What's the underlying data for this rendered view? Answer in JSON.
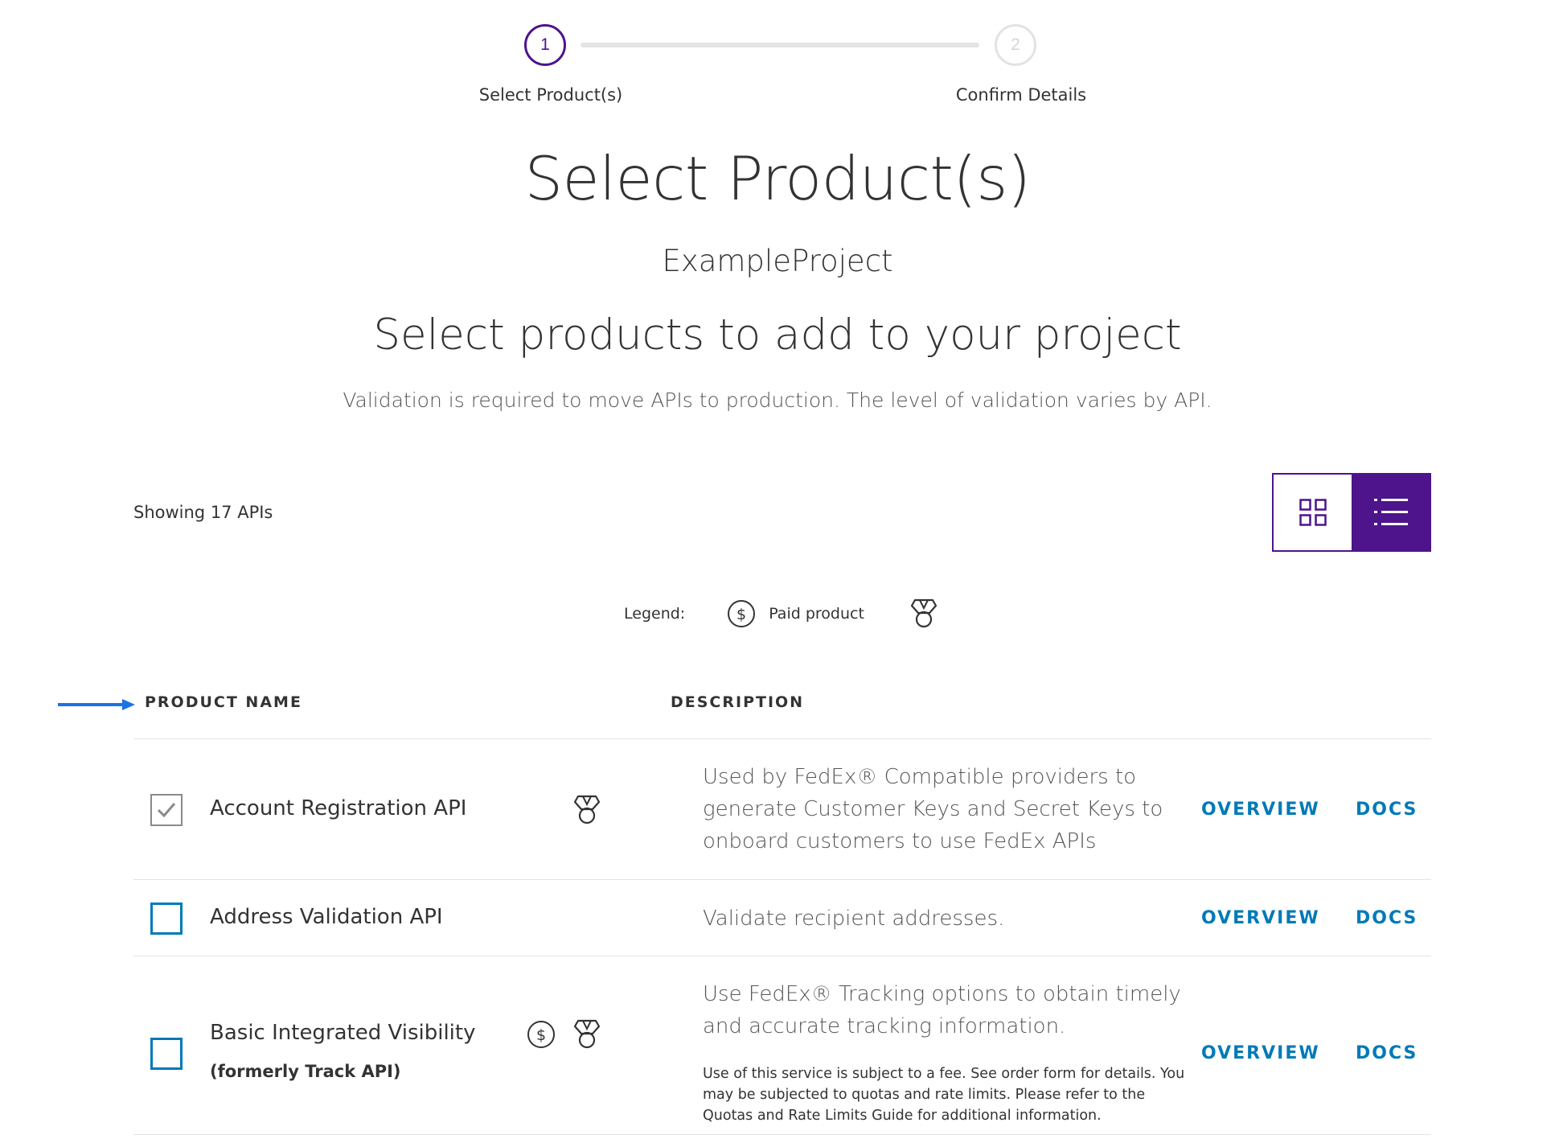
{
  "stepper": {
    "steps": [
      {
        "number": "1",
        "label": "Select Product(s)",
        "state": "active"
      },
      {
        "number": "2",
        "label": "Confirm Details",
        "state": "inactive"
      }
    ]
  },
  "page": {
    "title": "Select Product(s)",
    "project_name": "ExampleProject",
    "heading": "Select products to add to your project",
    "subtext": "Validation is required to move APIs to production. The level of validation varies by API."
  },
  "toolbar": {
    "showing_text": "Showing 17 APIs",
    "view_toggle": {
      "grid_icon": "grid-view-icon",
      "list_icon": "list-view-icon",
      "active": "list"
    }
  },
  "legend": {
    "label": "Legend:",
    "items": [
      {
        "icon": "dollar-icon",
        "label": "Paid product"
      },
      {
        "icon": "medal-icon",
        "label": ""
      }
    ]
  },
  "table": {
    "headers": [
      "PRODUCT NAME",
      "DESCRIPTION"
    ],
    "rows": [
      {
        "name": "Account Registration API",
        "subname": "",
        "checked": true,
        "icons": [
          "medal-icon"
        ],
        "description": "Used by FedEx® Compatible providers to generate Customer Keys and Secret Keys to onboard customers to use FedEx APIs",
        "note": "",
        "overview_label": "OVERVIEW",
        "docs_label": "DOCS"
      },
      {
        "name": "Address Validation API",
        "subname": "",
        "checked": false,
        "icons": [],
        "description": "Validate recipient addresses.",
        "note": "",
        "overview_label": "OVERVIEW",
        "docs_label": "DOCS"
      },
      {
        "name": "Basic Integrated Visibility",
        "subname": "(formerly Track API)",
        "checked": false,
        "icons": [
          "dollar-icon",
          "medal-icon"
        ],
        "description": "Use FedEx® Tracking options to obtain timely and accurate tracking information.",
        "note": "Use of this service is subject to a fee. See order form for details. You may be subjected to quotas and rate limits. Please refer to the Quotas and Rate Limits Guide for additional information.",
        "overview_label": "OVERVIEW",
        "docs_label": "DOCS"
      }
    ]
  },
  "colors": {
    "brand_purple": "#4d148c",
    "link_blue": "#007ab7",
    "arrow_blue": "#1a73e8",
    "divider": "#e3e3e3"
  }
}
